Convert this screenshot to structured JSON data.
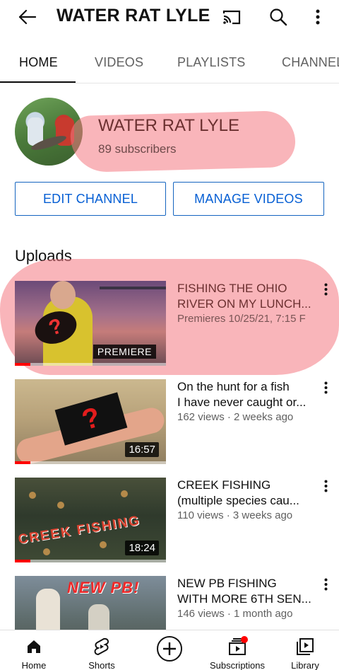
{
  "appbar": {
    "title": "WATER RAT LYLE",
    "icons": [
      "back-arrow-icon",
      "cast-icon",
      "search-icon",
      "more-vert-icon"
    ]
  },
  "tabs": [
    {
      "label": "HOME",
      "active": true
    },
    {
      "label": "VIDEOS",
      "active": false
    },
    {
      "label": "PLAYLISTS",
      "active": false
    },
    {
      "label": "CHANNEL",
      "active": false
    }
  ],
  "channel": {
    "name": "WATER RAT LYLE",
    "subscribers": "89 subscribers",
    "edit_label": "EDIT CHANNEL",
    "manage_label": "MANAGE VIDEOS"
  },
  "uploads": {
    "heading": "Uploads",
    "videos": [
      {
        "title_line1": "FISHING THE OHIO",
        "title_line2": "RIVER ON MY LUNCH...",
        "meta": "Premieres 10/25/21, 7:15 F",
        "badge": "PREMIERE",
        "thumb_mark": "?"
      },
      {
        "title_line1": "On the hunt for a fish",
        "title_line2": "I have never caught or...",
        "meta": "162 views · 2 weeks ago",
        "duration": "16:57",
        "thumb_mark": "?"
      },
      {
        "title_line1": "CREEK FISHING",
        "title_line2": "(multiple species cau...",
        "meta": "110 views · 3 weeks ago",
        "duration": "18:24",
        "thumb_text": "CREEK FISHING"
      },
      {
        "title_line1": "NEW PB FISHING",
        "title_line2": "WITH MORE 6TH SEN...",
        "meta": "146 views · 1 month ago",
        "thumb_text": "NEW PB!"
      }
    ]
  },
  "bottomnav": {
    "home": "Home",
    "shorts": "Shorts",
    "subscriptions": "Subscriptions",
    "library": "Library"
  },
  "colors": {
    "accent_blue": "#065fd4",
    "highlight_pink": "#f47882",
    "progress_red": "#ff0000"
  }
}
